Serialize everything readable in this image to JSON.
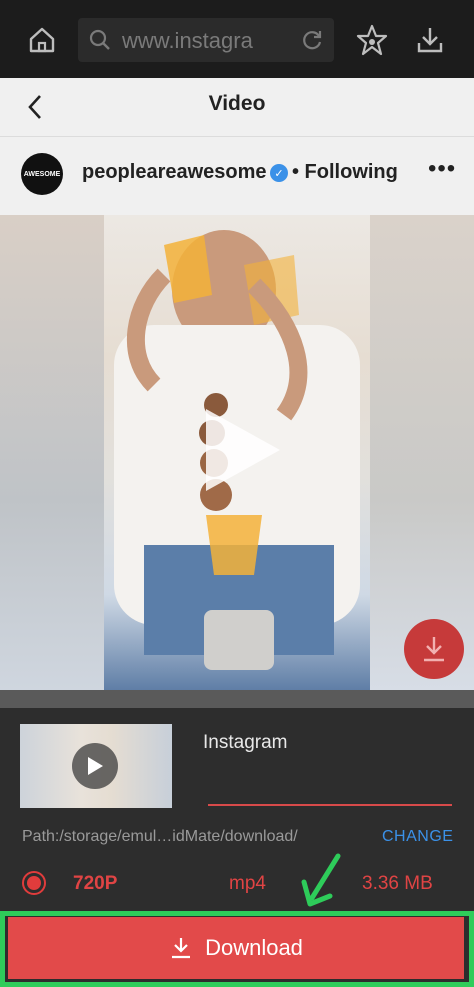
{
  "browser": {
    "url_text": "www.instagra",
    "icons": [
      "home-icon",
      "search-icon",
      "refresh-icon",
      "bookmark-star-icon",
      "download-icon"
    ]
  },
  "header": {
    "title": "Video"
  },
  "profile": {
    "avatar_text": "AWESOME",
    "username": "peopleareawesome",
    "separator_follow": "• Following",
    "more": "•••"
  },
  "sheet": {
    "source": "Instagram",
    "path": "Path:/storage/emul…idMate/download/",
    "change": "CHANGE",
    "resolution": "720P",
    "format": "mp4",
    "size": "3.36 MB",
    "download_label": "Download"
  },
  "colors": {
    "accent_red": "#e24a4a",
    "link_blue": "#3b91e8",
    "highlight_green": "#2ecc5a"
  }
}
